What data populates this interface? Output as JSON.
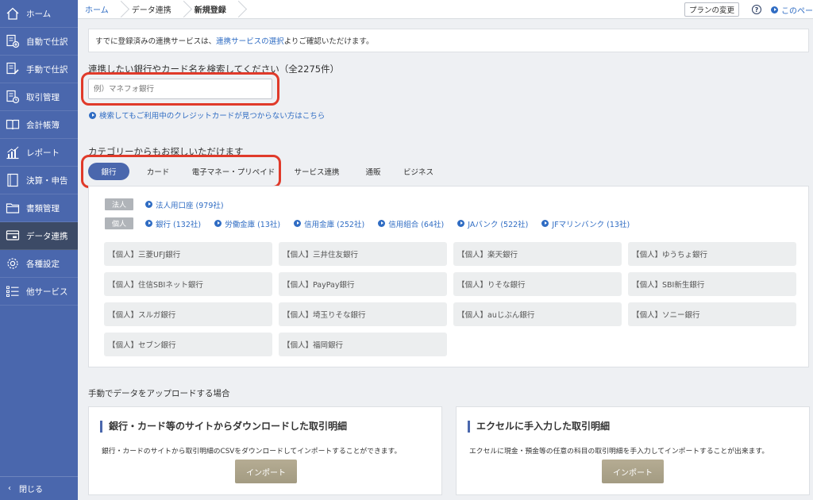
{
  "sidebar": {
    "items": [
      {
        "label": "ホーム",
        "icon": "home-icon"
      },
      {
        "label": "自動で仕訳",
        "icon": "auto-journal-icon"
      },
      {
        "label": "手動で仕訳",
        "icon": "manual-journal-icon"
      },
      {
        "label": "取引管理",
        "icon": "transaction-icon"
      },
      {
        "label": "会計帳簿",
        "icon": "book-icon"
      },
      {
        "label": "レポート",
        "icon": "report-chart-icon"
      },
      {
        "label": "決算・申告",
        "icon": "tax-return-icon"
      },
      {
        "label": "書類管理",
        "icon": "folder-icon"
      },
      {
        "label": "データ連携",
        "icon": "data-link-icon",
        "active": true
      },
      {
        "label": "各種設定",
        "icon": "gear-icon"
      },
      {
        "label": "他サービス",
        "icon": "list-icon"
      }
    ],
    "close_label": "閉じる"
  },
  "breadcrumb": {
    "home": "ホーム",
    "data_link": "データ連携",
    "current": "新規登録"
  },
  "topbar": {
    "plan_button": "プランの変更",
    "help": "?",
    "page_link": "このペー"
  },
  "notice": {
    "prefix": "すでに登録済みの連携サービスは、",
    "link": "連携サービスの選択",
    "suffix": "よりご確認いただけます。"
  },
  "search": {
    "title": "連携したい銀行やカード名を検索してください（全2275件）",
    "placeholder": "例）マネフォ銀行",
    "value": "",
    "help_link": "検索してもご利用中のクレジットカードが見つからない方はこちら"
  },
  "category": {
    "title": "カテゴリーからもお探しいただけます",
    "tabs": [
      {
        "label": "銀行",
        "active": true
      },
      {
        "label": "カード"
      },
      {
        "label": "電子マネー・プリペイド"
      },
      {
        "label": "サービス連携"
      },
      {
        "label": "通販"
      },
      {
        "label": "ビジネス"
      }
    ],
    "corporate_badge": "法人",
    "corporate_links": [
      "法人用口座 (979社)"
    ],
    "personal_badge": "個人",
    "personal_links": [
      "銀行 (132社)",
      "労働金庫 (13社)",
      "信用金庫 (252社)",
      "信用組合 (64社)",
      "JAバンク (522社)",
      "JFマリンバンク (13社)"
    ],
    "banks": [
      "【個人】三菱UFJ銀行",
      "【個人】三井住友銀行",
      "【個人】楽天銀行",
      "【個人】ゆうちょ銀行",
      "【個人】住信SBIネット銀行",
      "【個人】PayPay銀行",
      "【個人】りそな銀行",
      "【個人】SBI新生銀行",
      "【個人】スルガ銀行",
      "【個人】埼玉りそな銀行",
      "【個人】auじぶん銀行",
      "【個人】ソニー銀行",
      "【個人】セブン銀行",
      "【個人】福岡銀行"
    ]
  },
  "upload": {
    "title": "手動でデータをアップロードする場合",
    "cards": [
      {
        "title": "銀行・カード等のサイトからダウンロードした取引明細",
        "desc": "銀行・カードのサイトから取引明細のCSVをダウンロードしてインポートすることができます。",
        "button": "インポート"
      },
      {
        "title": "エクセルに手入力した取引明細",
        "desc": "エクセルに現金・預金等の任意の科目の取引明細を手入力してインポートすることが出来ます。",
        "button": "インポート"
      }
    ]
  },
  "colors": {
    "sidebar": "#4a67ad",
    "sidebar_active": "#3c4a66",
    "link": "#2f6cc3",
    "highlight": "#e03a2a",
    "import_button": "#ada58c"
  }
}
